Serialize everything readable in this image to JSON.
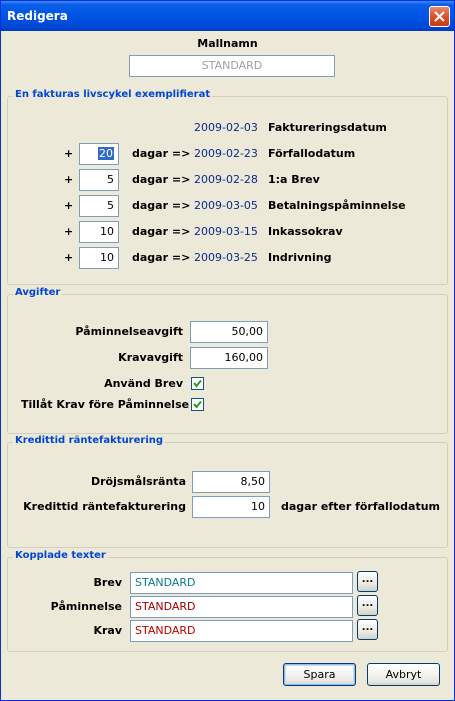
{
  "window": {
    "title": "Redigera"
  },
  "template": {
    "label": "Mallnamn",
    "value": "STANDARD"
  },
  "lifecycle": {
    "title": "En fakturas livscykel exemplifierat",
    "plus": "+",
    "unit": "dagar =>",
    "start": {
      "date": "2009-02-03",
      "label": "Faktureringsdatum"
    },
    "rows": [
      {
        "days": "20",
        "date": "2009-02-23",
        "label": "Förfallodatum"
      },
      {
        "days": "5",
        "date": "2009-02-28",
        "label": "1:a Brev"
      },
      {
        "days": "5",
        "date": "2009-03-05",
        "label": "Betalningspåminnelse"
      },
      {
        "days": "10",
        "date": "2009-03-15",
        "label": "Inkassokrav"
      },
      {
        "days": "10",
        "date": "2009-03-25",
        "label": "Indrivning"
      }
    ]
  },
  "fees": {
    "title": "Avgifter",
    "reminder_label": "Påminnelseavgift",
    "reminder_value": "50,00",
    "demand_label": "Kravavgift",
    "demand_value": "160,00",
    "use_letter_label": "Använd Brev",
    "use_letter_checked": true,
    "allow_label": "Tillåt Krav före Påminnelse",
    "allow_checked": true
  },
  "credit": {
    "title": "Kredittid räntefakturering",
    "rate_label": "Dröjsmålsränta",
    "rate_value": "8,50",
    "days_label": "Kredittid räntefakturering",
    "days_value": "10",
    "days_suffix": "dagar efter förfallodatum"
  },
  "texts": {
    "title": "Kopplade texter",
    "browse_label": "...",
    "items": [
      {
        "label": "Brev",
        "value": "STANDARD",
        "color": "#0a7a8a"
      },
      {
        "label": "Påminnelse",
        "value": "STANDARD",
        "color": "#a00000"
      },
      {
        "label": "Krav",
        "value": "STANDARD",
        "color": "#c00000"
      }
    ]
  },
  "buttons": {
    "save": "Spara",
    "cancel": "Avbryt"
  },
  "colors": {
    "titlebar": "#0055e5",
    "group_title": "#0046d5",
    "date": "#0b2a8c",
    "face": "#ece9d8"
  }
}
